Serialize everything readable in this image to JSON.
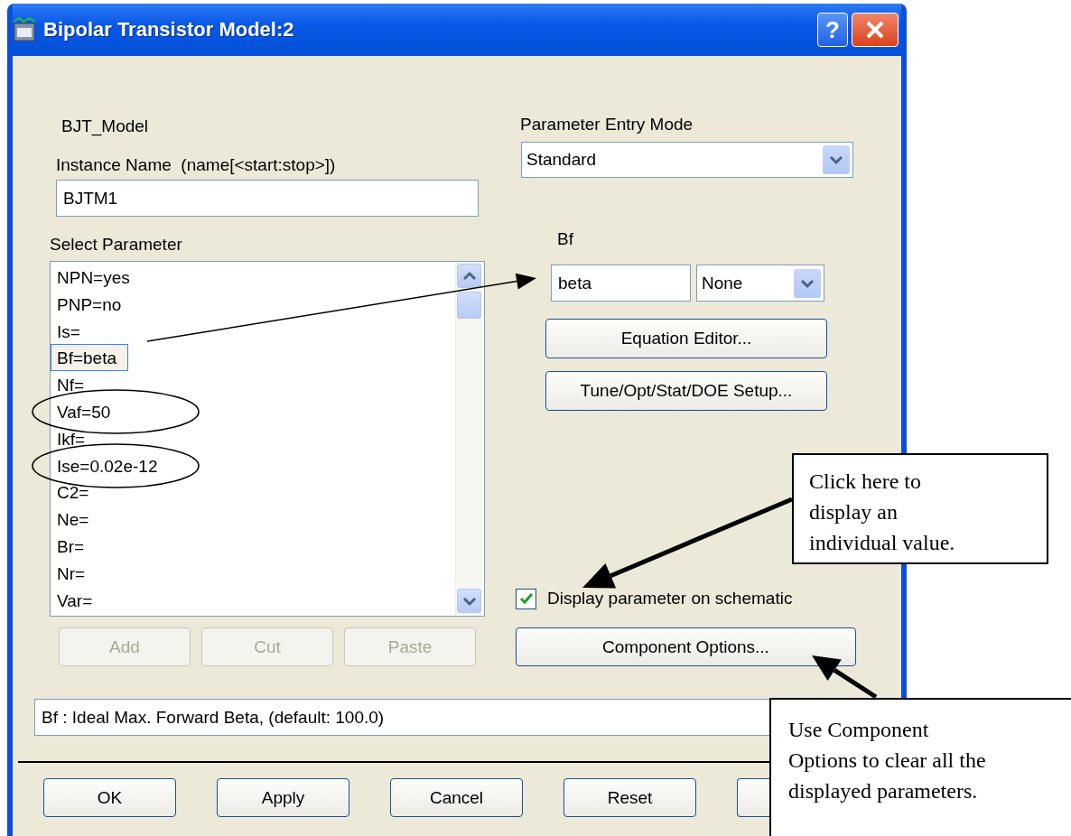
{
  "window": {
    "title": "Bipolar Transistor Model:2",
    "help_button": "?"
  },
  "model_name": "BJT_Model",
  "instance_name": {
    "label": "Instance Name  (name[<start:stop>])",
    "value": "BJTM1"
  },
  "parameter_entry_mode": {
    "label": "Parameter Entry Mode",
    "value": "Standard"
  },
  "select_parameter": {
    "label": "Select Parameter",
    "items": [
      {
        "text": "NPN=yes",
        "selected": false,
        "circled": false
      },
      {
        "text": "PNP=no",
        "selected": false,
        "circled": false
      },
      {
        "text": "Is=",
        "selected": false,
        "circled": false
      },
      {
        "text": "Bf=beta",
        "selected": true,
        "circled": false
      },
      {
        "text": "Nf=",
        "selected": false,
        "circled": false
      },
      {
        "text": "Vaf=50",
        "selected": false,
        "circled": true
      },
      {
        "text": "Ikf=",
        "selected": false,
        "circled": false
      },
      {
        "text": "Ise=0.02e-12",
        "selected": false,
        "circled": true
      },
      {
        "text": "C2=",
        "selected": false,
        "circled": false
      },
      {
        "text": "Ne=",
        "selected": false,
        "circled": false
      },
      {
        "text": "Br=",
        "selected": false,
        "circled": false
      },
      {
        "text": "Nr=",
        "selected": false,
        "circled": false
      },
      {
        "text": "Var=",
        "selected": false,
        "circled": false
      }
    ]
  },
  "list_buttons": [
    {
      "label": "Add",
      "disabled": true
    },
    {
      "label": "Cut",
      "disabled": true
    },
    {
      "label": "Paste",
      "disabled": true
    }
  ],
  "parameter": {
    "name": "Bf",
    "value": "beta",
    "unit": "None"
  },
  "parameter_buttons": [
    "Equation Editor...",
    "Tune/Opt/Stat/DOE Setup..."
  ],
  "display_on_schematic": {
    "label": "Display parameter on schematic",
    "checked": true
  },
  "component_options_button": "Component Options...",
  "description": "Bf : Ideal Max. Forward Beta, (default: 100.0)",
  "dialog_buttons": [
    "OK",
    "Apply",
    "Cancel",
    "Reset"
  ],
  "callouts": [
    {
      "lines": [
        "Click here to",
        "display an",
        "individual value."
      ]
    },
    {
      "lines": [
        "Use Component",
        "Options to clear all the",
        "displayed parameters."
      ]
    }
  ]
}
